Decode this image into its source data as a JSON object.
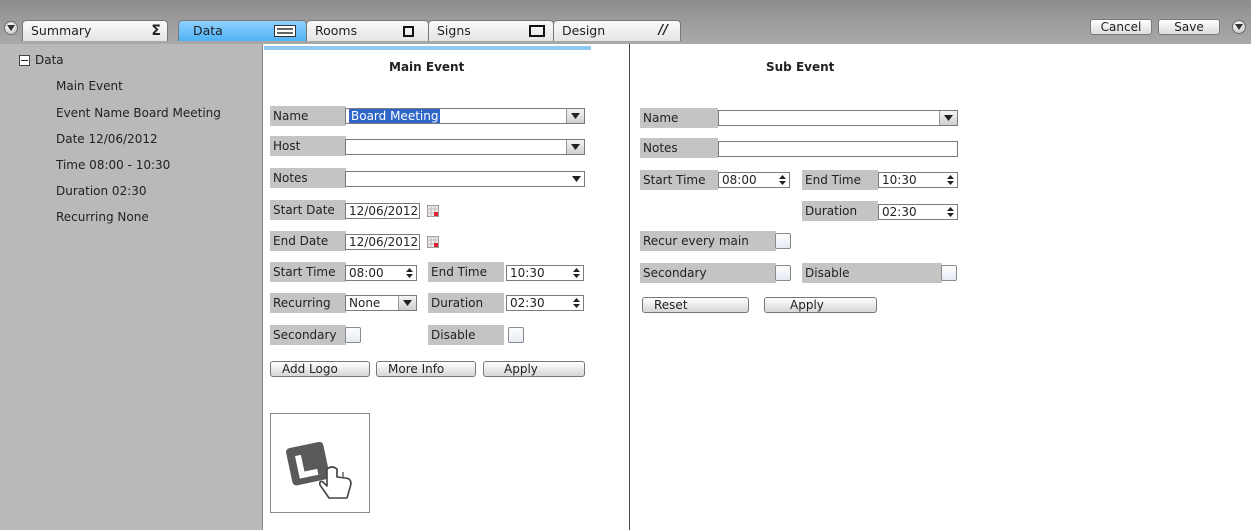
{
  "tabs": [
    {
      "label": "Summary",
      "icon": "sigma-icon"
    },
    {
      "label": "Data",
      "icon": "keyboard-icon"
    },
    {
      "label": "Rooms",
      "icon": "window-icon"
    },
    {
      "label": "Signs",
      "icon": "monitor-icon"
    },
    {
      "label": "Design",
      "icon": "pen-icon"
    }
  ],
  "toolbar": {
    "cancel_label": "Cancel",
    "save_label": "Save"
  },
  "tree": {
    "root": "Data",
    "items": [
      "Main Event",
      "Event Name Board Meeting",
      "Date 12/06/2012",
      "Time 08:00 - 10:30",
      "Duration 02:30",
      "Recurring None"
    ]
  },
  "main_event": {
    "title": "Main Event",
    "name_label": "Name",
    "name_value": "Board Meeting",
    "host_label": "Host",
    "host_value": "",
    "notes_label": "Notes",
    "notes_value": "",
    "start_date_label": "Start Date",
    "start_date_value": "12/06/2012",
    "end_date_label": "End Date",
    "end_date_value": "12/06/2012",
    "start_time_label": "Start Time",
    "start_time_value": "08:00",
    "end_time_label": "End Time",
    "end_time_value": "10:30",
    "recurring_label": "Recurring",
    "recurring_value": "None",
    "duration_label": "Duration",
    "duration_value": "02:30",
    "secondary_label": "Secondary",
    "disable_label": "Disable",
    "add_logo_label": "Add Logo",
    "more_info_label": "More Info",
    "apply_label": "Apply",
    "logo_icon": "logo-placeholder-hand-icon"
  },
  "sub_event": {
    "title": "Sub Event",
    "name_label": "Name",
    "name_value": "",
    "notes_label": "Notes",
    "notes_value": "",
    "start_time_label": "Start Time",
    "start_time_value": "08:00",
    "end_time_label": "End Time",
    "end_time_value": "10:30",
    "duration_label": "Duration",
    "duration_value": "02:30",
    "recur_label": "Recur every main",
    "secondary_label": "Secondary",
    "disable_label": "Disable",
    "reset_label": "Reset",
    "apply_label": "Apply"
  },
  "colors": {
    "active_tab": "#4fb3f5",
    "panel_gray": "#b9b9b9",
    "label_gray": "#c4c4c4",
    "accent": "#8fc8f3"
  }
}
